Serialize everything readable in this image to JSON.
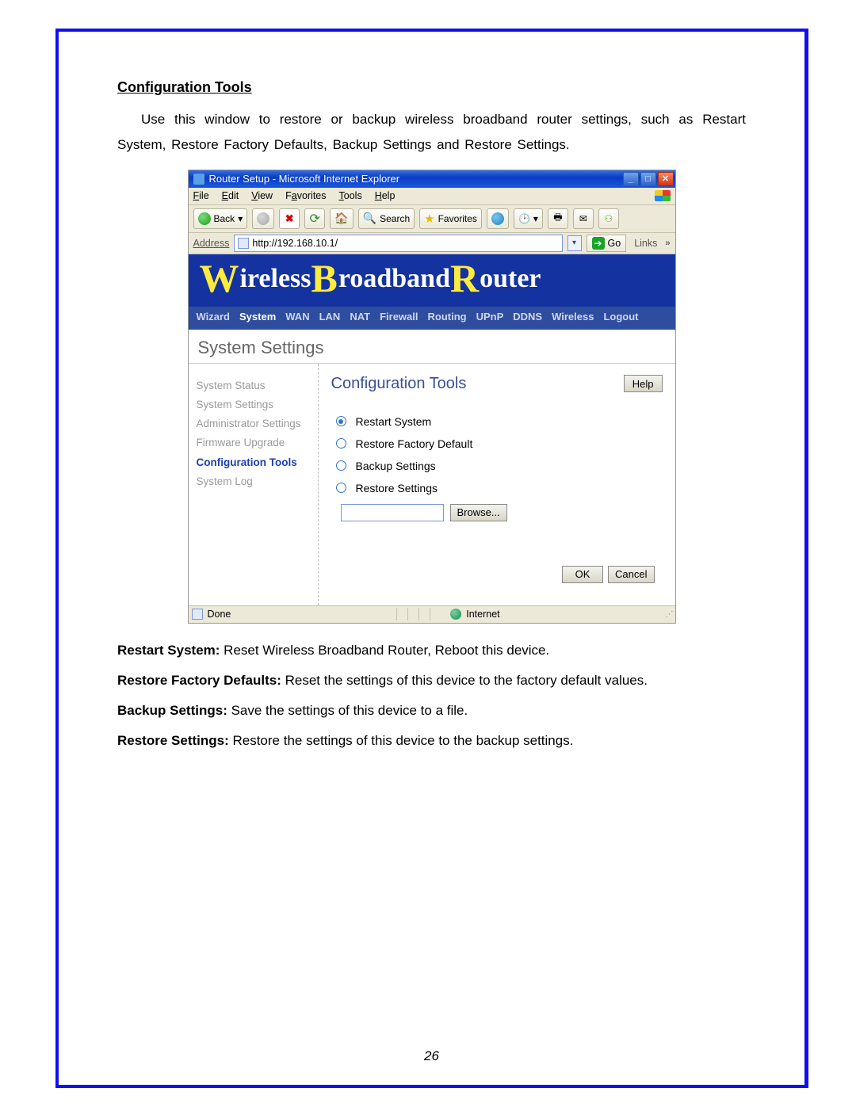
{
  "doc": {
    "section_title": "Configuration Tools",
    "intro_text": "Use this window to restore or backup wireless broadband router settings, such as Restart System, Restore Factory Defaults, Backup Settings and Restore Settings.",
    "page_number": "26"
  },
  "browser": {
    "window_title": "Router Setup - Microsoft Internet Explorer",
    "menu": {
      "file": "File",
      "edit": "Edit",
      "view": "View",
      "favorites": "Favorites",
      "tools": "Tools",
      "help": "Help"
    },
    "toolbar": {
      "back": "Back",
      "search": "Search",
      "favorites": "Favorites"
    },
    "address_label": "Address",
    "address_url": "http://192.168.10.1/",
    "go_label": "Go",
    "links_label": "Links",
    "status_done": "Done",
    "status_zone": "Internet"
  },
  "router": {
    "banner_words": [
      "W",
      "ireless ",
      "B",
      "roadband ",
      "R",
      "outer"
    ],
    "tabs": [
      "Wizard",
      "System",
      "WAN",
      "LAN",
      "NAT",
      "Firewall",
      "Routing",
      "UPnP",
      "DDNS",
      "Wireless",
      "Logout"
    ],
    "active_tab_index": 1,
    "page_heading": "System Settings",
    "sidebar_items": [
      "System Status",
      "System Settings",
      "Administrator Settings",
      "Firmware Upgrade",
      "Configuration Tools",
      "System Log"
    ],
    "sidebar_selected": 4,
    "content_title": "Configuration Tools",
    "help_label": "Help",
    "options": [
      {
        "label": "Restart System",
        "selected": true
      },
      {
        "label": "Restore Factory Default",
        "selected": false
      },
      {
        "label": "Backup Settings",
        "selected": false
      },
      {
        "label": "Restore Settings",
        "selected": false
      }
    ],
    "browse_label": "Browse...",
    "ok_label": "OK",
    "cancel_label": "Cancel"
  },
  "defs": {
    "restart_b": "Restart System:",
    "restart_t": " Reset Wireless Broadband Router, Reboot this device.",
    "factory_b": "Restore Factory Defaults:",
    "factory_t": " Reset the settings of this device to the factory default values.",
    "backup_b": "Backup Settings:",
    "backup_t": " Save the settings of this device to a file.",
    "restore_b": "Restore Settings:",
    "restore_t": " Restore the settings of this device to the backup settings."
  }
}
